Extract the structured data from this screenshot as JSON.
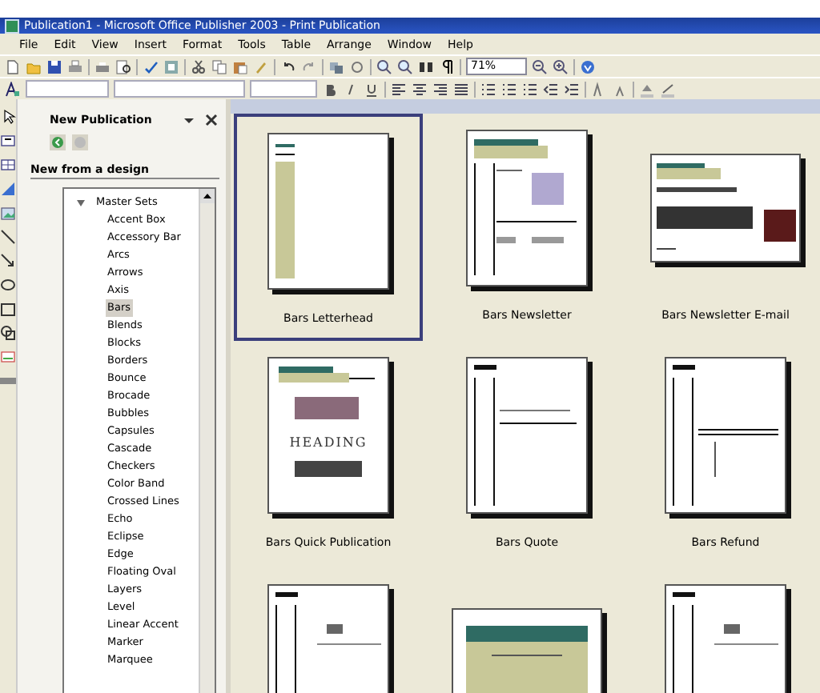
{
  "window": {
    "title": "Publication1 - Microsoft Office Publisher 2003 - Print Publication"
  },
  "menu_bar": [
    "File",
    "Edit",
    "View",
    "Insert",
    "Format",
    "Tools",
    "Table",
    "Arrange",
    "Window",
    "Help"
  ],
  "standard_toolbar": {
    "zoom": "71%"
  },
  "task_pane": {
    "title": "New Publication",
    "section": "New from a design",
    "tree": [
      {
        "label": "Master Sets",
        "expanded": true,
        "selected": false,
        "children": [
          {
            "label": "Accent Box",
            "selected": false
          },
          {
            "label": "Accessory Bar",
            "selected": false
          },
          {
            "label": "Arcs",
            "selected": false
          },
          {
            "label": "Arrows",
            "selected": false
          },
          {
            "label": "Axis",
            "selected": false
          },
          {
            "label": "Bars",
            "selected": true
          },
          {
            "label": "Blends",
            "selected": false
          },
          {
            "label": "Blocks",
            "selected": false
          },
          {
            "label": "Borders",
            "selected": false
          },
          {
            "label": "Bounce",
            "selected": false
          },
          {
            "label": "Brocade",
            "selected": false
          },
          {
            "label": "Bubbles",
            "selected": false
          },
          {
            "label": "Capsules",
            "selected": false
          },
          {
            "label": "Cascade",
            "selected": false
          },
          {
            "label": "Checkers",
            "selected": false
          },
          {
            "label": "Color Band",
            "selected": false
          },
          {
            "label": "Crossed Lines",
            "selected": false
          },
          {
            "label": "Echo",
            "selected": false
          },
          {
            "label": "Eclipse",
            "selected": false
          },
          {
            "label": "Edge",
            "selected": false
          },
          {
            "label": "Floating Oval",
            "selected": false
          },
          {
            "label": "Layers",
            "selected": false
          },
          {
            "label": "Level",
            "selected": false
          },
          {
            "label": "Linear Accent",
            "selected": false
          },
          {
            "label": "Marker",
            "selected": false
          },
          {
            "label": "Marquee",
            "selected": false
          }
        ]
      }
    ]
  },
  "gallery": {
    "items": [
      {
        "kind": "letterhead",
        "label": "Bars Letterhead",
        "selected": true
      },
      {
        "kind": "newsletter",
        "label": "Bars Newsletter",
        "selected": false
      },
      {
        "kind": "email",
        "label": "Bars Newsletter E-mail",
        "selected": false
      },
      {
        "kind": "quick",
        "label": "Bars Quick Publication",
        "heading": "HEADING",
        "selected": false
      },
      {
        "kind": "quote",
        "label": "Bars Quote",
        "selected": false
      },
      {
        "kind": "refund",
        "label": "Bars Refund",
        "selected": false
      },
      {
        "kind": "form",
        "selected": false
      },
      {
        "kind": "flyer",
        "selected": false
      },
      {
        "kind": "form",
        "selected": false
      }
    ]
  }
}
